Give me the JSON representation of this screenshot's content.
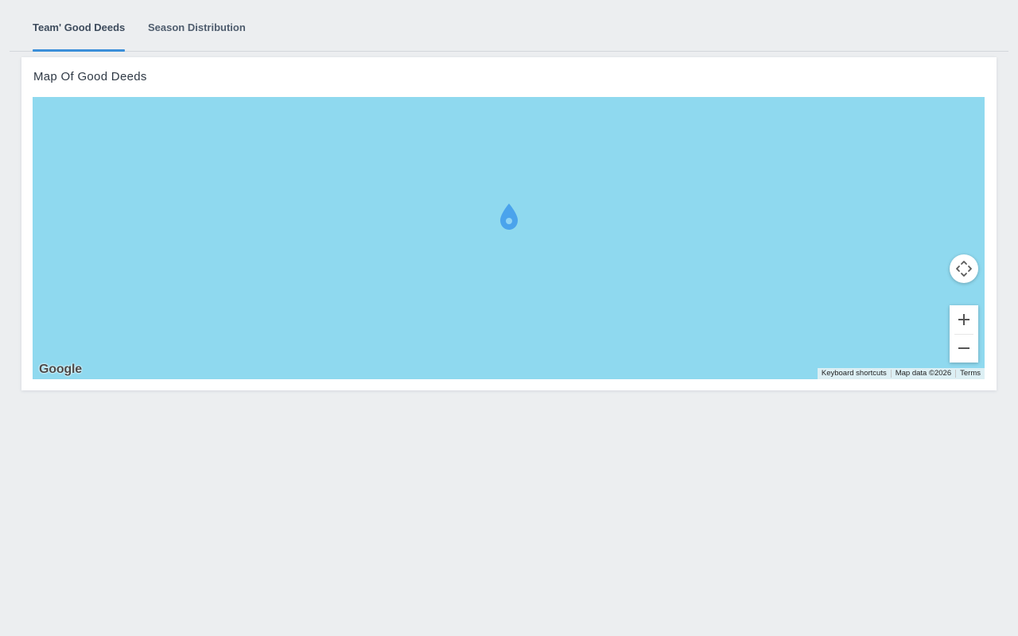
{
  "tabs": [
    {
      "label": "Team' Good Deeds",
      "active": true
    },
    {
      "label": "Season Distribution",
      "active": false
    }
  ],
  "card": {
    "title": "Map Of Good Deeds"
  },
  "map": {
    "water_color": "#8fd9ef",
    "marker_color": "#4aa3ec",
    "logo": "Google",
    "attribution": {
      "keyboard_shortcuts": "Keyboard shortcuts",
      "map_data": "Map data ©2026",
      "terms": "Terms"
    },
    "controls": {
      "pan_icon": "camera-control-icon",
      "zoom_in_icon": "plus-icon",
      "zoom_out_icon": "minus-icon"
    }
  },
  "colors": {
    "accent": "#3b8fd9",
    "background": "#eceef0"
  }
}
